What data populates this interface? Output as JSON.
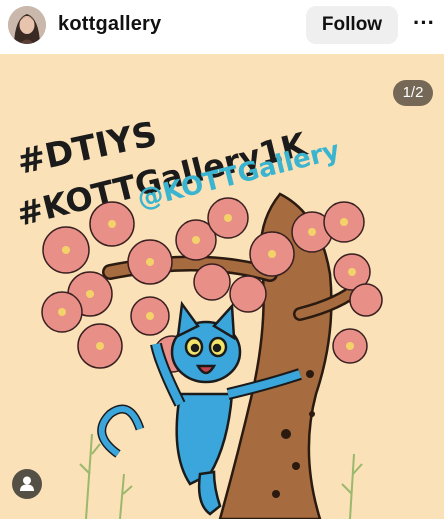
{
  "header": {
    "username": "kottgallery",
    "follow_label": "Follow",
    "more_label": "···"
  },
  "post": {
    "counter": "1/2",
    "artwork_text": {
      "line1": "#DTIYS",
      "line2": "#KOTTGallery1K",
      "line3": "@KOTTGallery"
    }
  },
  "colors": {
    "post_background": "#fae1b8",
    "follow_button_bg": "#efefef",
    "cat_blue": "#3aa6dc",
    "handle_blue": "#3bb4d0",
    "blossom_pink": "#e88f88",
    "trunk_brown": "#a66b3f"
  },
  "icons": {
    "more": "ellipsis-icon",
    "tag": "user-tag-icon"
  }
}
